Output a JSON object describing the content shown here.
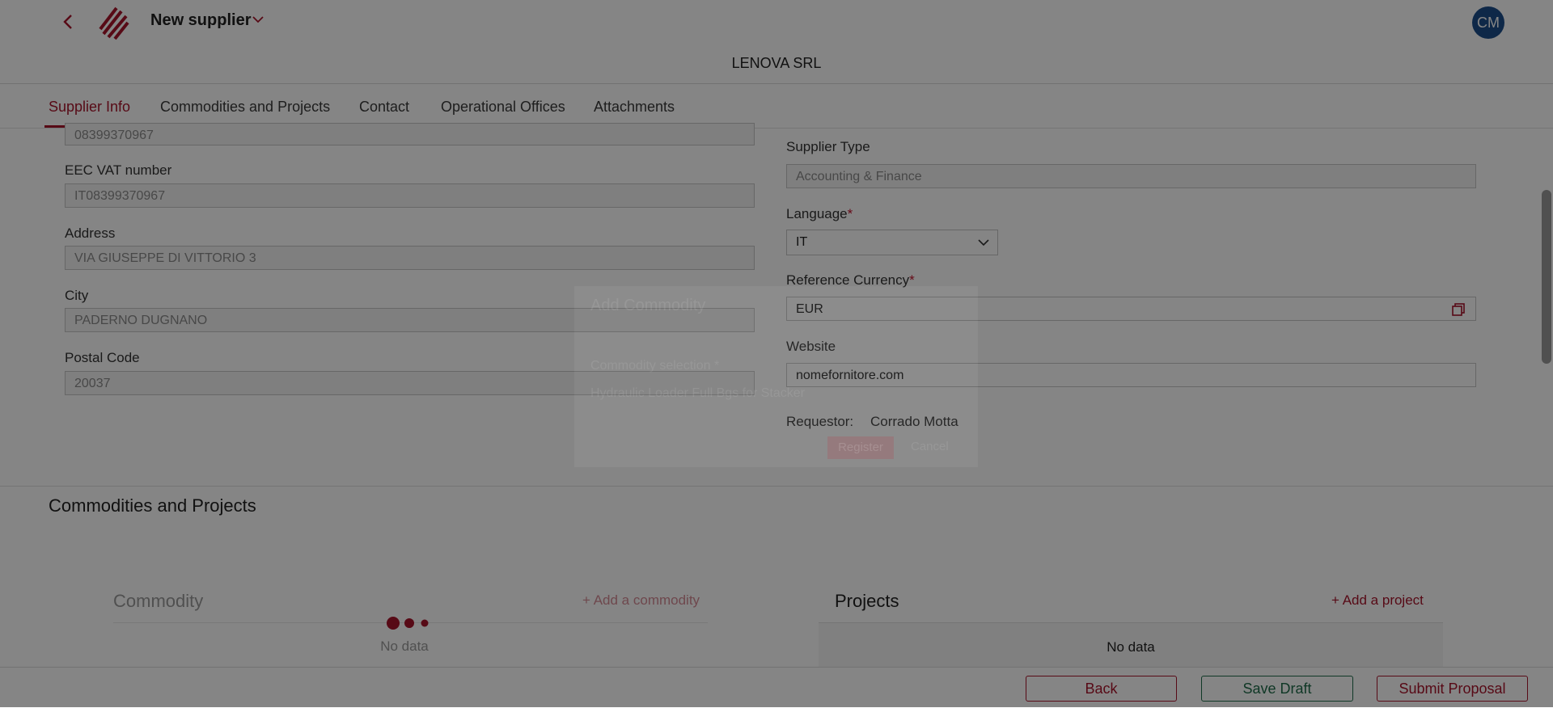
{
  "header": {
    "title": "New supplier",
    "company": "LENOVA SRL",
    "avatar_initials": "CM"
  },
  "tabs": [
    {
      "label": "Supplier Info",
      "active": true
    },
    {
      "label": "Commodities and Projects",
      "active": false
    },
    {
      "label": "Contact",
      "active": false
    },
    {
      "label": "Operational Offices",
      "active": false
    },
    {
      "label": "Attachments",
      "active": false
    }
  ],
  "form": {
    "tax_code_value": "08399370967",
    "vat_label": "EEC VAT number",
    "vat_value": "IT08399370967",
    "address_label": "Address",
    "address_value": "VIA GIUSEPPE DI VITTORIO 3",
    "city_label": "City",
    "city_value": "PADERNO DUGNANO",
    "postal_label": "Postal Code",
    "postal_value": "20037",
    "supplier_type_label": "Supplier Type",
    "supplier_type_value": "Accounting & Finance",
    "language_label": "Language",
    "language_value": "IT",
    "currency_label": "Reference Currency",
    "currency_value": "EUR",
    "website_label": "Website",
    "website_value": "nomefornitore.com",
    "required_mark": "*",
    "requestor_label": "Requestor:",
    "requestor_value": "Corrado Motta"
  },
  "section": {
    "title": "Commodities and Projects",
    "commodity_title": "Commodity",
    "add_commodity": "+ Add a commodity",
    "commodity_empty": "No data",
    "projects_title": "Projects",
    "add_project": "+ Add a project",
    "projects_empty": "No data"
  },
  "modal": {
    "title": "Add Commodity",
    "field_label": "Commodity selection *",
    "field_value": "Hydraulic Loader Full Bgs for Stacker",
    "register": "Register",
    "cancel": "Cancel"
  },
  "footer": {
    "back": "Back",
    "save_draft": "Save Draft",
    "submit": "Submit Proposal"
  },
  "colors": {
    "brand_red": "#a8142b",
    "green": "#1f6b4a",
    "avatar_blue": "#1c4e8a",
    "overlay": "rgba(0,0,0,0.48)"
  }
}
